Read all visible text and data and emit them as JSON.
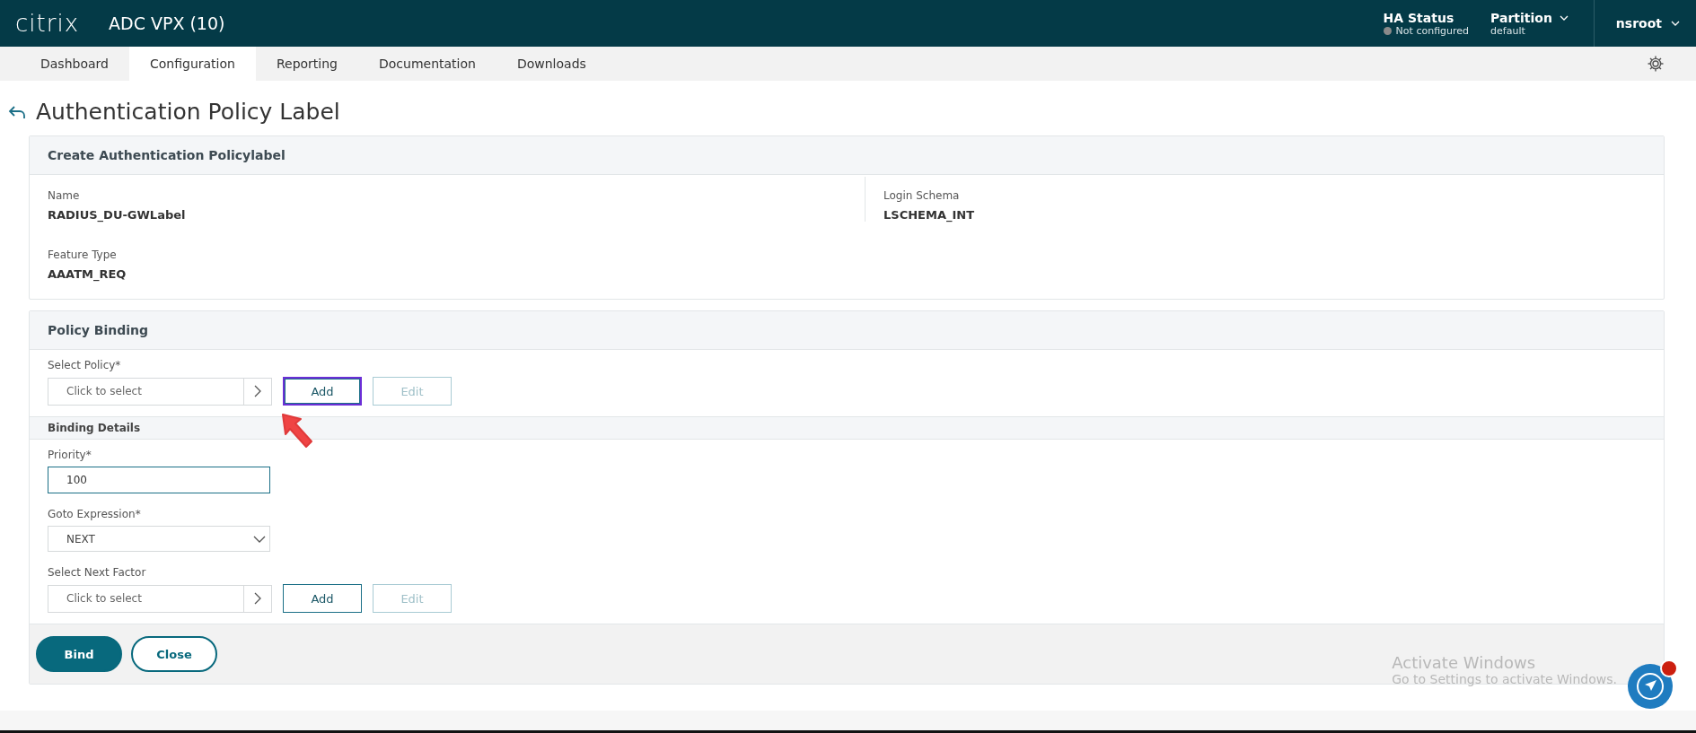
{
  "header": {
    "logo": "citrix",
    "product": "ADC VPX (10)",
    "ha_status": {
      "label": "HA Status",
      "value": "Not configured"
    },
    "partition": {
      "label": "Partition",
      "value": "default"
    },
    "user": "nsroot"
  },
  "tabs": [
    {
      "label": "Dashboard",
      "selected": false
    },
    {
      "label": "Configuration",
      "selected": true
    },
    {
      "label": "Reporting",
      "selected": false
    },
    {
      "label": "Documentation",
      "selected": false
    },
    {
      "label": "Downloads",
      "selected": false
    }
  ],
  "page_title": "Authentication Policy Label",
  "create_card": {
    "title": "Create Authentication Policylabel",
    "fields": [
      {
        "label": "Name",
        "value": "RADIUS_DU-GWLabel"
      },
      {
        "label": "Login Schema",
        "value": "LSCHEMA_INT"
      },
      {
        "label": "Feature Type",
        "value": "AAATM_REQ"
      }
    ]
  },
  "policy_binding": {
    "title": "Policy Binding",
    "select_policy": {
      "label": "Select Policy*",
      "placeholder": "Click to select",
      "add": {
        "label": "Add",
        "focused": true
      },
      "edit": {
        "label": "Edit",
        "disabled": true
      }
    },
    "binding_details_title": "Binding Details",
    "priority": {
      "label": "Priority*",
      "value": "100"
    },
    "goto_expression": {
      "label": "Goto Expression*",
      "value": "NEXT"
    },
    "next_factor": {
      "label": "Select Next Factor",
      "placeholder": "Click to select",
      "add": {
        "label": "Add",
        "focused": false
      },
      "edit": {
        "label": "Edit",
        "disabled": true
      }
    },
    "buttons": [
      {
        "label": "Bind",
        "kind": "primary"
      },
      {
        "label": "Close",
        "kind": "secondary"
      }
    ]
  },
  "activation_notice": {
    "title": "Activate Windows",
    "subtitle": "Go to Settings to activate Windows."
  }
}
